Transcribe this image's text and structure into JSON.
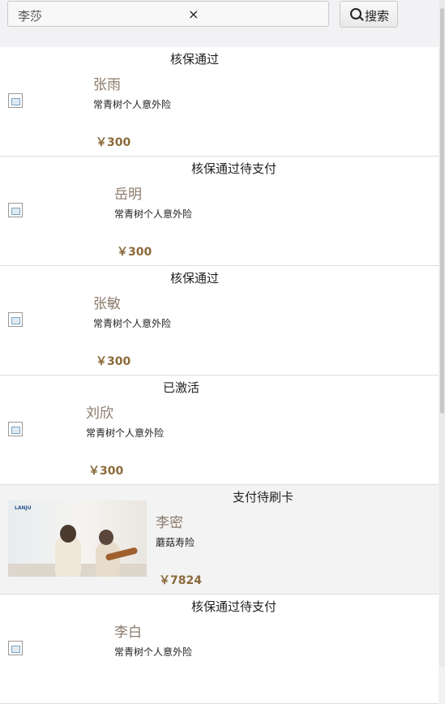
{
  "search": {
    "value": "李莎",
    "clear_icon": "×",
    "button_label": "搜索"
  },
  "records": [
    {
      "status": "核保通过",
      "name": "张雨",
      "product": "常青树个人意外险",
      "price": "￥300",
      "image": "broken-image"
    },
    {
      "status": "核保通过待支付",
      "name": "岳明",
      "product": "常青树个人意外险",
      "price": "￥300",
      "image": "broken-image"
    },
    {
      "status": "核保通过",
      "name": "张敏",
      "product": "常青树个人意外险",
      "price": "￥300",
      "image": "broken-image"
    },
    {
      "status": "已激活",
      "name": "刘欣",
      "product": "常青树个人意外险",
      "price": "￥300",
      "image": "broken-image"
    },
    {
      "status": "支付待刷卡",
      "name": "李密",
      "product": "蘑菇寿险",
      "price": "￥7824",
      "image": "photo"
    },
    {
      "status": "核保通过待支付",
      "name": "李白",
      "product": "常青树个人意外险",
      "price": "",
      "image": "broken-image"
    }
  ],
  "colors": {
    "name": "#8a7a6a",
    "price": "#8a6a3a",
    "background": "#f2f2f4"
  }
}
